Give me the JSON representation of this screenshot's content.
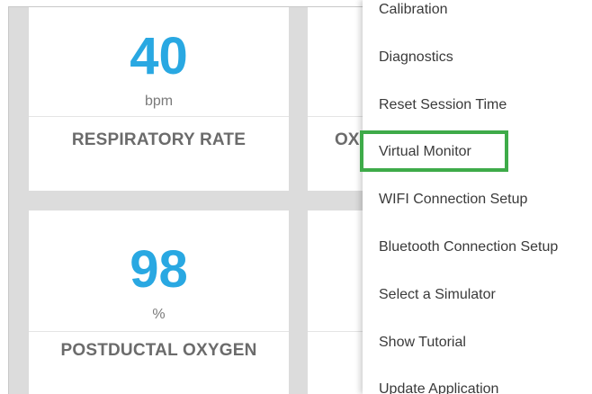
{
  "cards": [
    {
      "value": "40",
      "unit": "bpm",
      "label": "RESPIRATORY RATE"
    },
    {
      "label_partial": "OX"
    },
    {
      "value": "98",
      "unit": "%",
      "label": "POSTDUCTAL OXYGEN"
    }
  ],
  "menu": {
    "items": [
      {
        "label": "Calibration"
      },
      {
        "label": "Diagnostics"
      },
      {
        "label": "Reset Session Time"
      },
      {
        "label": "Virtual Monitor"
      },
      {
        "label": "WIFI Connection Setup"
      },
      {
        "label": "Bluetooth Connection Setup"
      },
      {
        "label": "Select a Simulator"
      },
      {
        "label": "Show Tutorial"
      },
      {
        "label": "Update Application"
      }
    ],
    "highlighted_item": "Virtual Monitor",
    "highlight_color": "#3eab49"
  },
  "colors": {
    "value_accent": "#29a8e2",
    "background": "#dcdcdc"
  }
}
